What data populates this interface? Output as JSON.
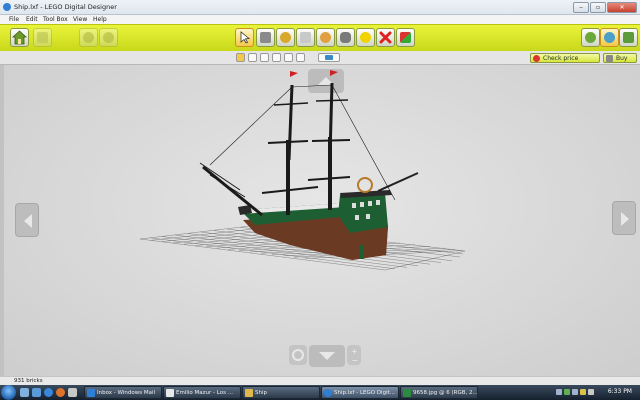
{
  "window": {
    "title": "Ship.lxf - LEGO Digital Designer"
  },
  "menu": [
    "File",
    "Edit",
    "Tool Box",
    "View",
    "Help"
  ],
  "toolbar_right": {
    "check_price": "Check price",
    "buy": "Buy"
  },
  "status": {
    "text": "931 bricks"
  },
  "taskbar": {
    "tasks": [
      {
        "label": "Inbox - Windows Mail",
        "color": "#2f7fd6"
      },
      {
        "label": "Emilio Mazur - Los ...",
        "color": "#e8e8e8"
      },
      {
        "label": "Ship",
        "color": "#e0b84a"
      },
      {
        "label": "Ship.lxf - LEGO Digit...",
        "color": "#2f7fd6"
      },
      {
        "label": "9658.jpg @ 6 (RGB, 2...",
        "color": "#2b8a3e"
      }
    ],
    "clock": "6:33 PM"
  }
}
